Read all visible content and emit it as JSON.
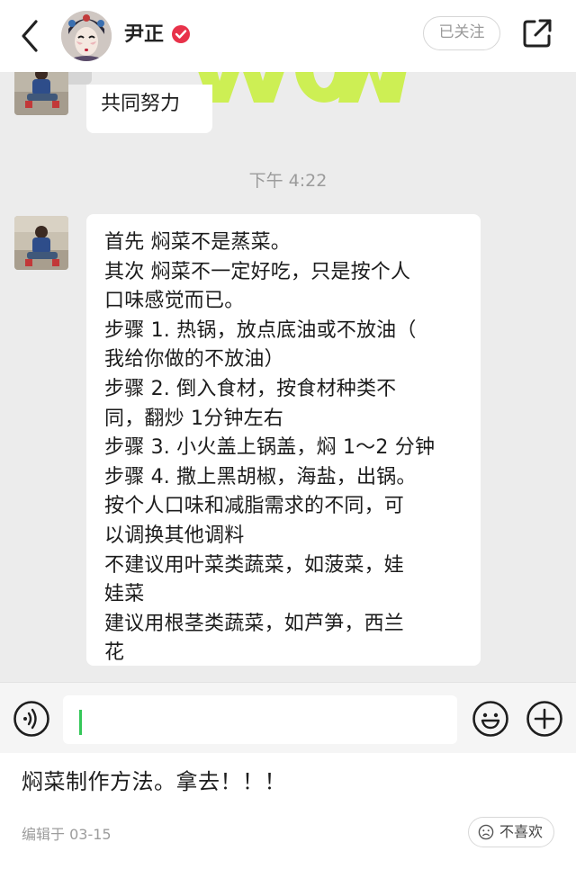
{
  "header": {
    "author_name": "尹正",
    "follow_label": "已关注"
  },
  "chat": {
    "prev_message": "共同努力",
    "time": "下午 4:22",
    "message_lines": [
      "首先 焖菜不是蒸菜。",
      "其次 焖菜不一定好吃，只是按个人",
      "口味感觉而已。",
      "步骤 1. 热锅，放点底油或不放油（",
      "我给你做的不放油）",
      "步骤 2. 倒入食材，按食材种类不",
      "同，翻炒 1分钟左右",
      "步骤 3. 小火盖上锅盖，焖 1～2 分钟",
      "步骤 4. 撒上黑胡椒，海盐，出锅。",
      "按个人口味和减脂需求的不同，可",
      "以调换其他调料",
      "不建议用叶菜类蔬菜，如菠菜，娃",
      "娃菜",
      "建议用根茎类蔬菜，如芦笋，西兰",
      "花"
    ],
    "input_value": ""
  },
  "post": {
    "text": "焖菜制作方法。拿去！！！",
    "edit_info": "编辑于 03-15",
    "dislike_label": "不喜欢"
  },
  "colors": {
    "verified_badge": "#e8324a",
    "chat_background": "#ececec",
    "caret": "#34c759",
    "wow_art": "#c8f03a"
  },
  "icons": [
    "back-arrow-icon",
    "verified-badge-icon",
    "share-icon",
    "voice-icon",
    "emoji-icon",
    "plus-icon",
    "sad-face-icon"
  ]
}
